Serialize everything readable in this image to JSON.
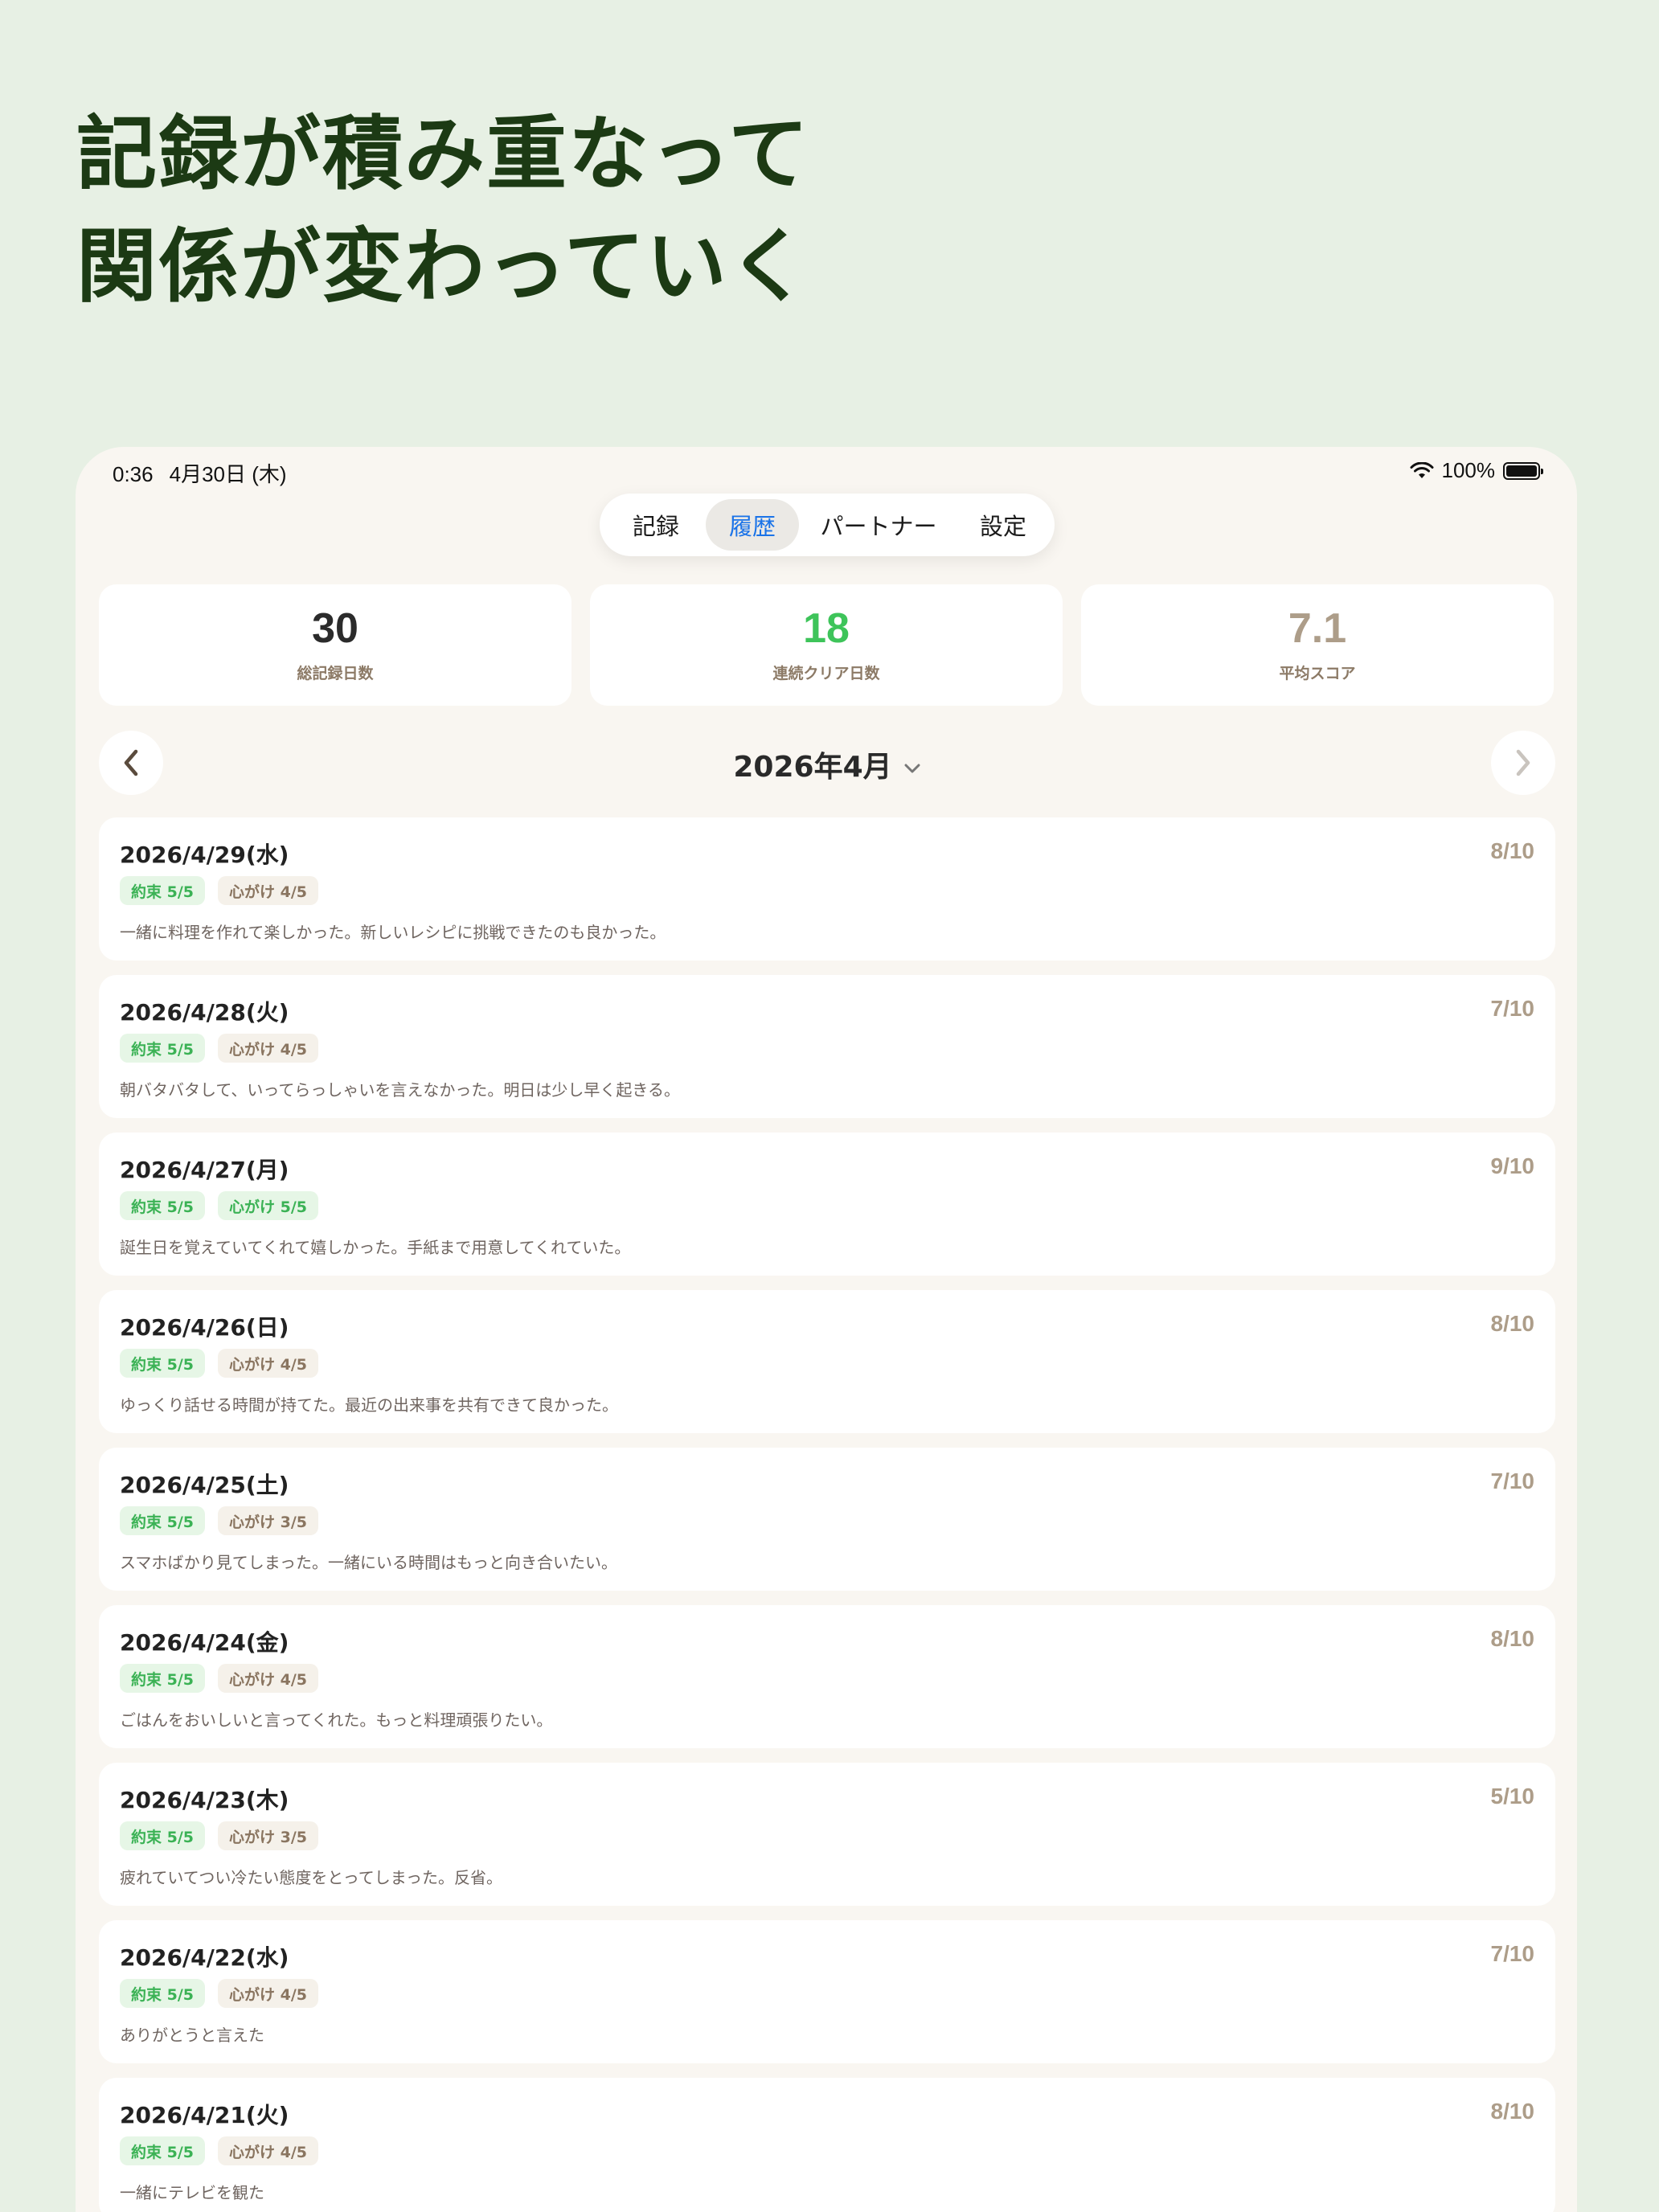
{
  "headline": {
    "line1": "記録が積み重なって",
    "line2": "関係が変わっていく"
  },
  "status_bar": {
    "time": "0:36",
    "date": "4月30日 (木)",
    "battery": "100%",
    "battery_level": 1.0
  },
  "tabs": [
    {
      "label": "記録",
      "active": false
    },
    {
      "label": "履歴",
      "active": true
    },
    {
      "label": "パートナー",
      "active": false
    },
    {
      "label": "設定",
      "active": false
    }
  ],
  "stats": [
    {
      "value": "30",
      "label": "総記録日数",
      "color": "#2b2b2b"
    },
    {
      "value": "18",
      "label": "連続クリア日数",
      "color": "#3ec45a"
    },
    {
      "value": "7.1",
      "label": "平均スコア",
      "color": "#ad9d89"
    }
  ],
  "month_nav": {
    "label": "2026年4月",
    "prev_icon": "chevron-left-icon",
    "next_icon": "chevron-right-icon",
    "dropdown_icon": "chevron-down-icon"
  },
  "colors": {
    "accent_blue": "#1a73e8",
    "tag_green_text": "#3bb255",
    "tag_green_bg": "#e6f6e6",
    "score": "#ad9d89",
    "headline": "#1c3a14",
    "background": "#e7f0e4"
  },
  "entries": [
    {
      "date": "2026/4/29(水)",
      "score": "8/10",
      "promise": "約束 5/5",
      "mind": "心がけ 4/5",
      "mind_full": false,
      "note": "一緒に料理を作れて楽しかった。新しいレシピに挑戦できたのも良かった。"
    },
    {
      "date": "2026/4/28(火)",
      "score": "7/10",
      "promise": "約束 5/5",
      "mind": "心がけ 4/5",
      "mind_full": false,
      "note": "朝バタバタして、いってらっしゃいを言えなかった。明日は少し早く起きる。"
    },
    {
      "date": "2026/4/27(月)",
      "score": "9/10",
      "promise": "約束 5/5",
      "mind": "心がけ 5/5",
      "mind_full": true,
      "note": "誕生日を覚えていてくれて嬉しかった。手紙まで用意してくれていた。"
    },
    {
      "date": "2026/4/26(日)",
      "score": "8/10",
      "promise": "約束 5/5",
      "mind": "心がけ 4/5",
      "mind_full": false,
      "note": "ゆっくり話せる時間が持てた。最近の出来事を共有できて良かった。"
    },
    {
      "date": "2026/4/25(土)",
      "score": "7/10",
      "promise": "約束 5/5",
      "mind": "心がけ 3/5",
      "mind_full": false,
      "note": "スマホばかり見てしまった。一緒にいる時間はもっと向き合いたい。"
    },
    {
      "date": "2026/4/24(金)",
      "score": "8/10",
      "promise": "約束 5/5",
      "mind": "心がけ 4/5",
      "mind_full": false,
      "note": "ごはんをおいしいと言ってくれた。もっと料理頑張りたい。"
    },
    {
      "date": "2026/4/23(木)",
      "score": "5/10",
      "promise": "約束 5/5",
      "mind": "心がけ 3/5",
      "mind_full": false,
      "note": "疲れていてつい冷たい態度をとってしまった。反省。"
    },
    {
      "date": "2026/4/22(水)",
      "score": "7/10",
      "promise": "約束 5/5",
      "mind": "心がけ 4/5",
      "mind_full": false,
      "note": "ありがとうと言えた"
    },
    {
      "date": "2026/4/21(火)",
      "score": "8/10",
      "promise": "約束 5/5",
      "mind": "心がけ 4/5",
      "mind_full": false,
      "note": "一緒にテレビを観た"
    }
  ]
}
